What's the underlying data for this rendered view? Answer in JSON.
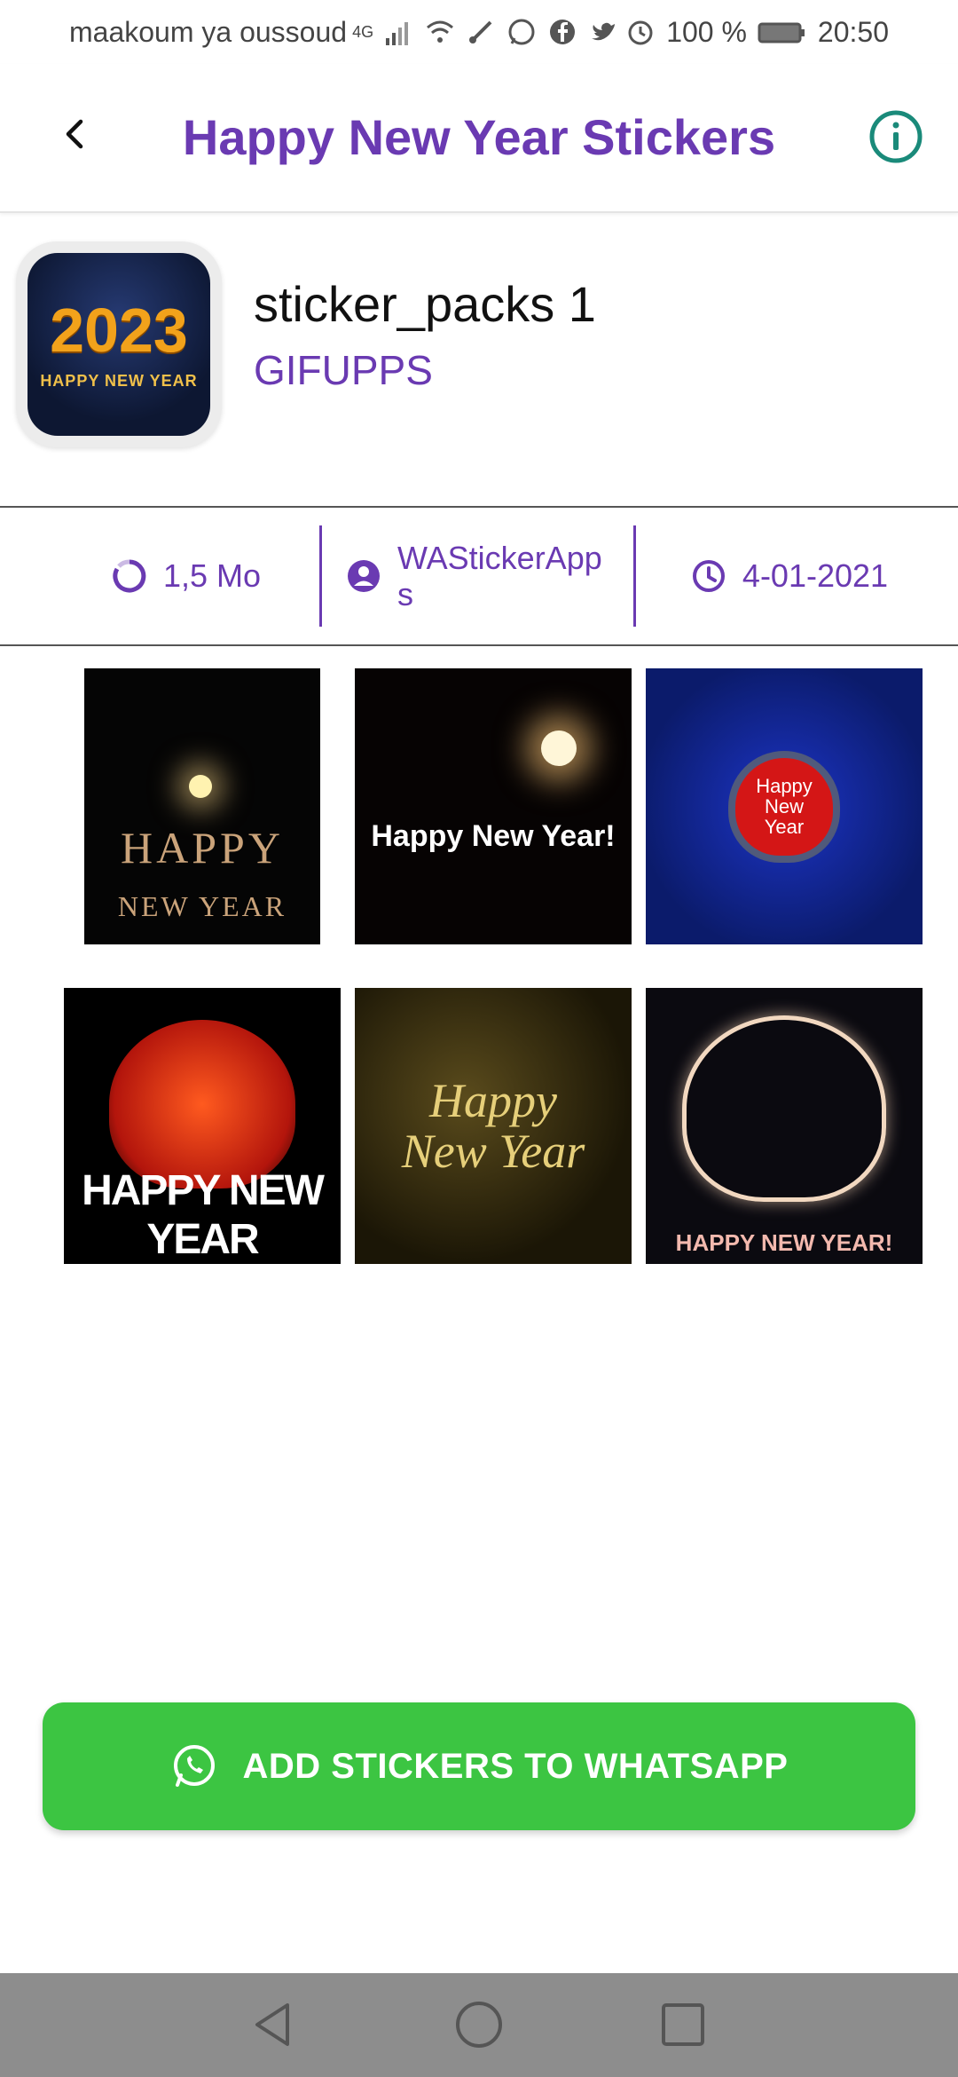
{
  "status_bar": {
    "carrier": "maakoum ya oussoud",
    "network": "4G",
    "battery": "100 %",
    "time": "20:50"
  },
  "app_bar": {
    "title": "Happy New Year Stickers"
  },
  "pack": {
    "icon_year": "2023",
    "icon_caption": "HAPPY NEW YEAR",
    "name": "sticker_packs 1",
    "publisher": "GIFUPPS"
  },
  "info": {
    "size": "1,5 Mo",
    "author_line1": "WAStickerApp",
    "author_line2": "s",
    "date": "4-01-2021"
  },
  "stickers": [
    {
      "line1": "HAPPY",
      "line2": "NEW YEAR"
    },
    {
      "line1": "Happy New Year!"
    },
    {
      "line1": "Happy",
      "line2": "New",
      "line3": "Year"
    },
    {
      "line1": "HAPPY NEW YEAR"
    },
    {
      "line1": "Happy",
      "line2": "New Year"
    },
    {
      "line1": "HAPPY NEW YEAR!"
    }
  ],
  "add_button": {
    "label": "ADD STICKERS TO WHATSAPP"
  },
  "colors": {
    "accent": "#6a3ab2",
    "info_icon": "#1a8a7a",
    "add_button": "#3cc542",
    "nav_bar": "#8d8d8d"
  }
}
